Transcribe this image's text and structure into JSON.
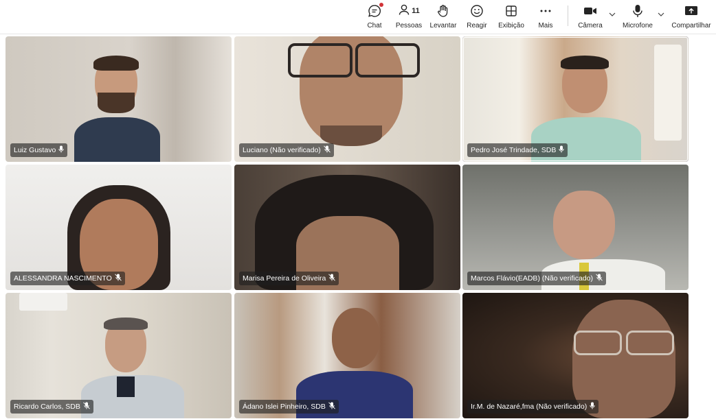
{
  "toolbar": {
    "chat_label": "Chat",
    "people_label": "Pessoas",
    "people_count": "11",
    "raise_label": "Levantar",
    "react_label": "Reagir",
    "view_label": "Exibição",
    "more_label": "Mais",
    "camera_label": "Câmera",
    "mic_label": "Microfone",
    "share_label": "Compartilhar"
  },
  "participants": [
    {
      "name": "Luiz Gustavo",
      "mic": "mic-icon"
    },
    {
      "name": "Luciano (Não verificado)",
      "mic": "mic-muted-icon"
    },
    {
      "name": "Pedro José Trindade, SDB",
      "mic": "mic-icon",
      "active_speaker": true
    },
    {
      "name": "ALESSANDRA NASCIMENTO",
      "mic": "mic-muted-icon"
    },
    {
      "name": "Marisa Pereira de Oliveira",
      "mic": "mic-muted-icon"
    },
    {
      "name": "Marcos Flávio(EADB) (Não verificado)",
      "mic": "mic-muted-icon"
    },
    {
      "name": "Ricardo Carlos, SDB",
      "mic": "mic-muted-icon"
    },
    {
      "name": "Ádano Islei Pinheiro, SDB",
      "mic": "mic-muted-icon"
    },
    {
      "name": "Ir.M. de Nazaré,fma (Não verificado)",
      "mic": "mic-icon"
    }
  ],
  "colors": {
    "accent": "#6264a7",
    "notification": "#d13438"
  }
}
